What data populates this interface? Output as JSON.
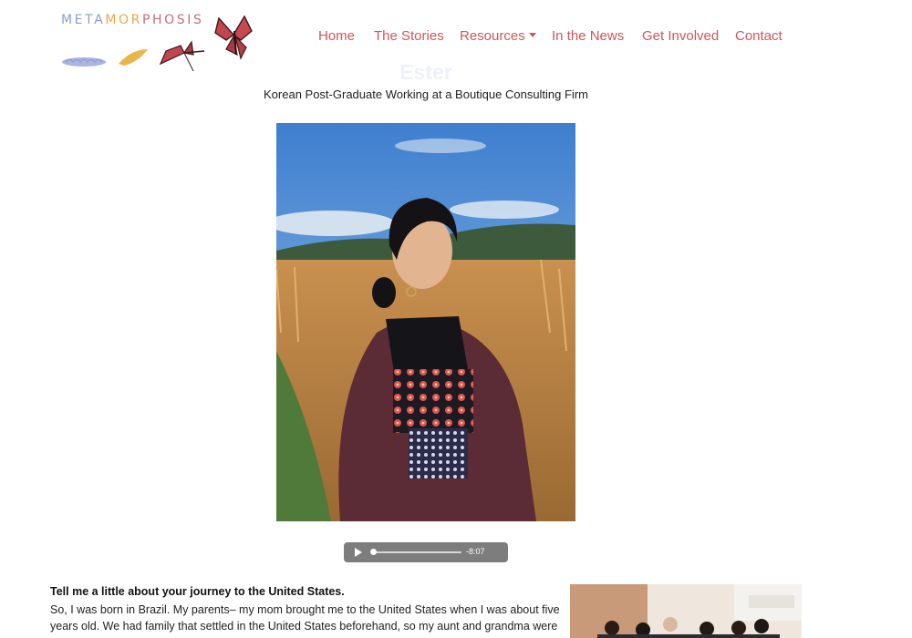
{
  "logo": {
    "word_part1": "META",
    "word_part2": "MOR",
    "word_part3": "PHOSIS",
    "colors": {
      "lavender": "#8f9bd0",
      "gold": "#e6a94a",
      "rose": "#c76d78"
    }
  },
  "nav": {
    "items": [
      {
        "label": "Home"
      },
      {
        "label": "The Stories"
      },
      {
        "label": "Resources"
      },
      {
        "label": "In the News"
      },
      {
        "label": "Get Involved"
      },
      {
        "label": "Contact"
      }
    ],
    "color": "#d1555b"
  },
  "story": {
    "title": "Ester",
    "subtitle": "Korean Post-Graduate Working at a Boutique Consulting Firm"
  },
  "audio": {
    "time_remaining": "-8:07",
    "progress": 0.0
  },
  "content": {
    "question": "Tell me a little about your journey to the United States.",
    "paragraph": "So, I was born in Brazil. My parents– my mom brought me to the United States when I was about five years old. We had family that settled in the United States beforehand, so my aunt and grandma were"
  },
  "icons": [
    "play-icon",
    "caret-down-icon",
    "caterpillar-icon",
    "chrysalis-icon",
    "butterfly-icon"
  ]
}
